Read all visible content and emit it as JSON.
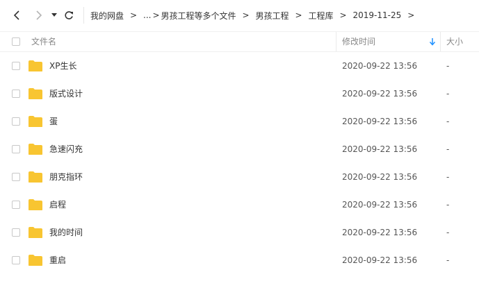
{
  "nav": {
    "back_icon": "chevron-left-icon",
    "forward_icon": "chevron-right-icon",
    "history_icon": "caret-down-icon",
    "refresh_icon": "refresh-icon"
  },
  "breadcrumb": {
    "items": [
      "我的网盘",
      "...",
      "男孩工程等多个文件",
      "男孩工程",
      "工程库",
      "2019-11-25"
    ],
    "separator": ">"
  },
  "header": {
    "name": "文件名",
    "modified": "修改时间",
    "size": "大小",
    "sort_icon": "arrow-down-icon",
    "sort_color": "#1e90ff"
  },
  "folder_color": "#f8c531",
  "files": [
    {
      "name": "XP生长",
      "modified": "2020-09-22 13:56",
      "size": "-"
    },
    {
      "name": "版式设计",
      "modified": "2020-09-22 13:56",
      "size": "-"
    },
    {
      "name": "蛋",
      "modified": "2020-09-22 13:56",
      "size": "-"
    },
    {
      "name": "急速闪充",
      "modified": "2020-09-22 13:56",
      "size": "-"
    },
    {
      "name": "朋克指环",
      "modified": "2020-09-22 13:56",
      "size": "-"
    },
    {
      "name": "启程",
      "modified": "2020-09-22 13:56",
      "size": "-"
    },
    {
      "name": "我的时间",
      "modified": "2020-09-22 13:56",
      "size": "-"
    },
    {
      "name": "重启",
      "modified": "2020-09-22 13:56",
      "size": "-"
    }
  ]
}
